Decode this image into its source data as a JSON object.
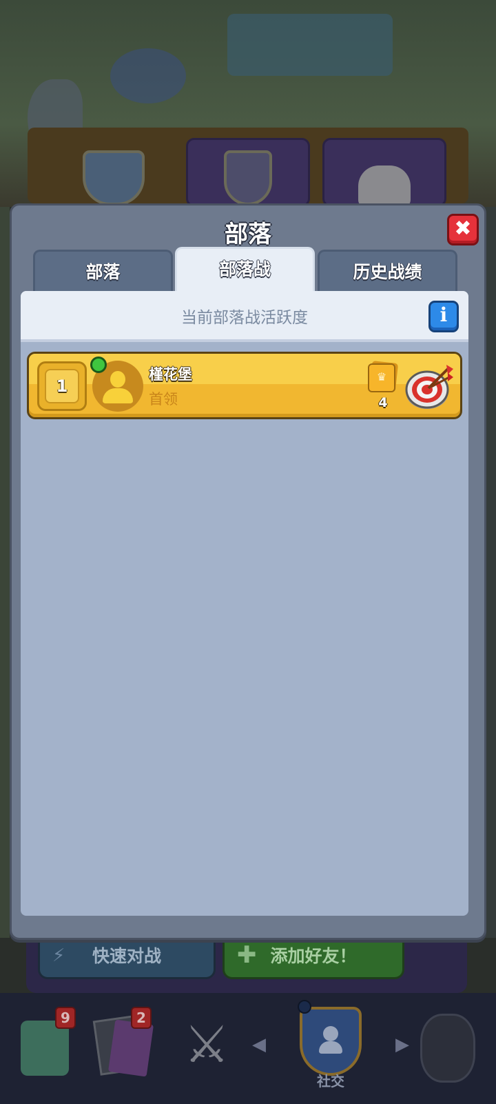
{
  "background": {
    "buttons": {
      "quick_battle": "快速对战",
      "add_friend": "添加好友！"
    }
  },
  "bottom_nav": {
    "shop_badge": "9",
    "cards_badge": "2",
    "social_label": "社交"
  },
  "modal": {
    "title": "部落",
    "close_icon": "close-icon",
    "tabs": [
      {
        "label": "部落",
        "active": false
      },
      {
        "label": "部落战",
        "active": true
      },
      {
        "label": "历史战绩",
        "active": false
      }
    ],
    "header": {
      "label": "当前部落战活跃度",
      "info_icon": "i"
    },
    "members": [
      {
        "rank": "1",
        "name": "槿花堡",
        "role": "首领",
        "online": true,
        "trophy_count": "4"
      }
    ]
  },
  "colors": {
    "modal_bg": "#6e7a8e",
    "content_bg": "#a3b2ca",
    "member_row": "#f1b730",
    "close_red": "#e5323b",
    "info_blue": "#2d8ae8",
    "online_green": "#3fc63f"
  }
}
